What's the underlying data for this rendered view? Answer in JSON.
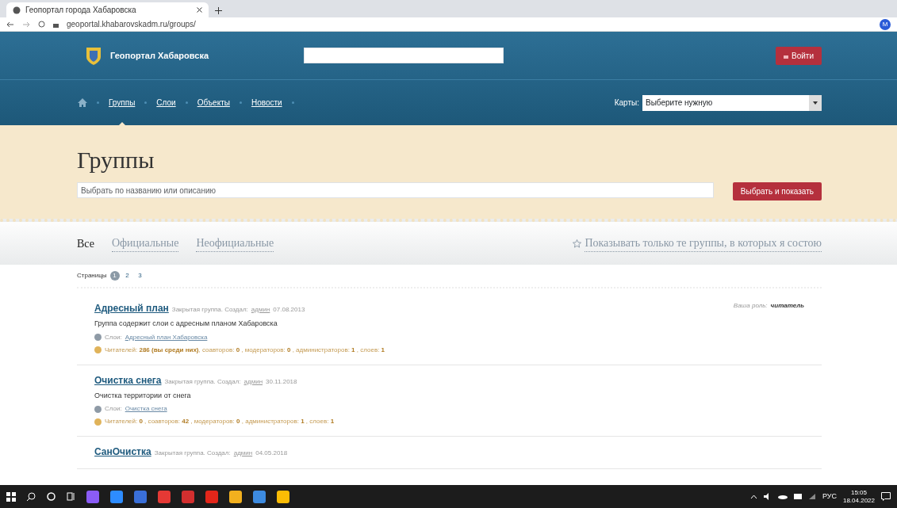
{
  "browser": {
    "tab_title": "Геопортал города Хабаровска",
    "url": "geoportal.khabarovskadm.ru/groups/",
    "profile": "M"
  },
  "header": {
    "site_title": "Геопортал Хабаровска",
    "login_button": "Войти",
    "nav": [
      {
        "label": "Группы",
        "selected": true
      },
      {
        "label": "Слои",
        "selected": false
      },
      {
        "label": "Объекты",
        "selected": false
      },
      {
        "label": "Новости",
        "selected": false
      }
    ],
    "maps_label": "Карты:",
    "maps_select": "Выберите нужную"
  },
  "hero": {
    "title": "Группы",
    "search_placeholder": "Выбрать по названию или описанию",
    "search_button": "Выбрать и показать"
  },
  "filter_tabs": [
    {
      "label": "Все",
      "selected": true
    },
    {
      "label": "Официальные",
      "selected": false
    },
    {
      "label": "Неофициальные",
      "selected": false
    }
  ],
  "only_mine": {
    "label": "Показывать только те группы, в которых я состою",
    "checked": false
  },
  "pages": {
    "label": "Страницы",
    "items": [
      {
        "label": "1",
        "selected": true
      },
      {
        "label": "2",
        "selected": false
      },
      {
        "label": "3",
        "selected": false
      }
    ]
  },
  "groups": [
    {
      "name": "Адресный план",
      "meta": "Закрытая группа. Создал:",
      "creator": "админ",
      "date": "07.08.2013",
      "description": "Группа содержит слои с адресным планом Хабаровска",
      "layers_label": "Слои:",
      "layers_link": "Адресный план Хабаровска",
      "stats": "Читателей: **286 (вы среди них)**, соавторов: **0** , модераторов: **0** , администраторов: **1** , слоев: **1**",
      "role_label": "Ваша роль:",
      "role": "читатель"
    },
    {
      "name": "Очистка снега",
      "meta": "Закрытая группа. Создал:",
      "creator": "админ",
      "date": "30.11.2018",
      "description": "Очистка территории от снега",
      "layers_label": "Слои:",
      "layers_link": "Очистка снега",
      "stats": "Читателей: **0** , соавторов: **42** , модераторов: **0** , администраторов: **1** , слоев: **1**"
    },
    {
      "name": "СанОчистка",
      "meta": "Закрытая группа. Создал:",
      "creator": "админ",
      "date": "04.05.2018"
    }
  ],
  "taskbar": {
    "language": "РУС",
    "time": "15:05",
    "date": "18.04.2022"
  }
}
